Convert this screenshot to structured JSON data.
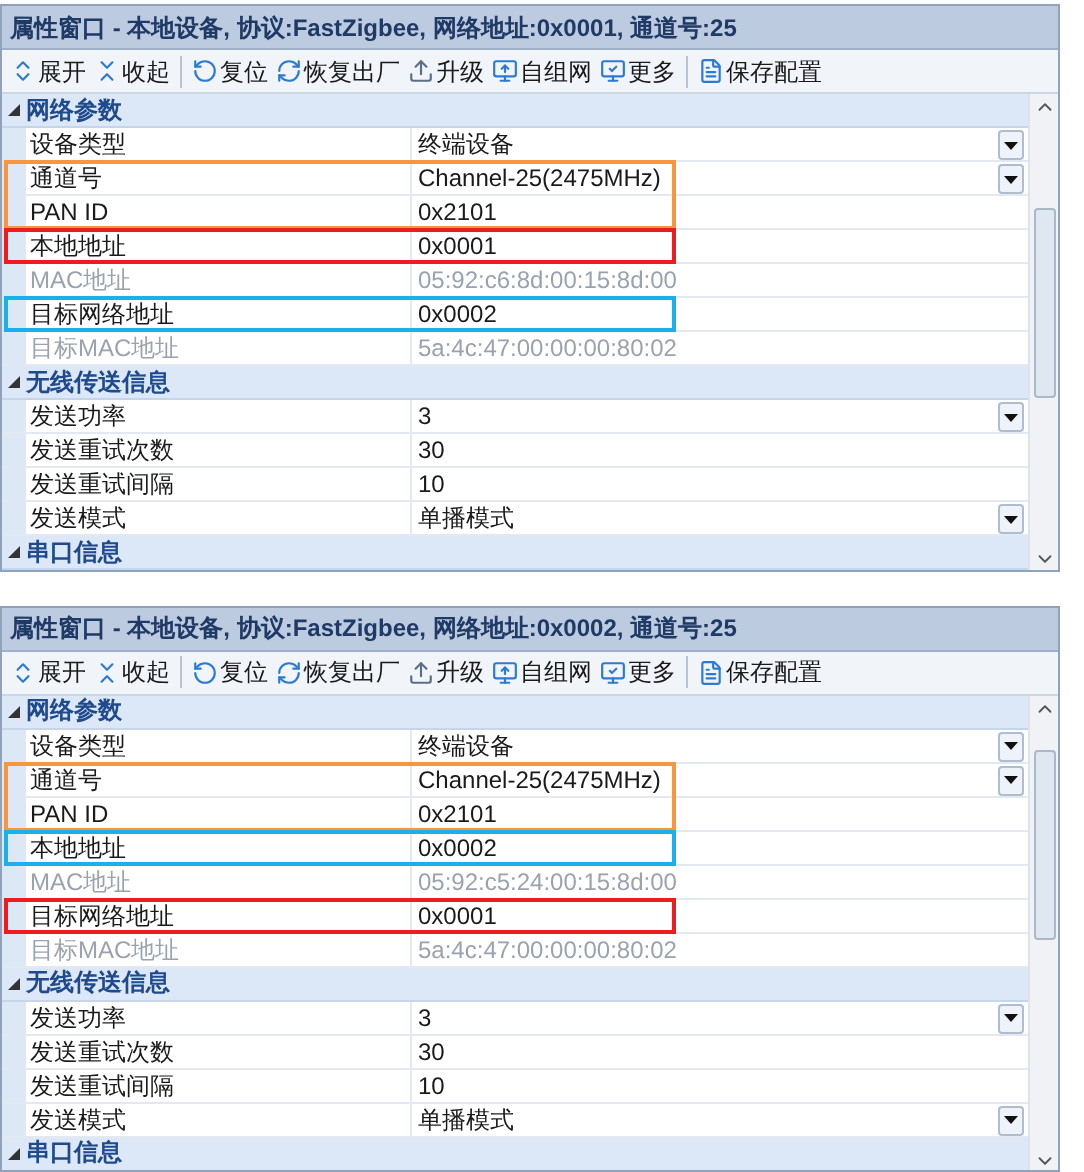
{
  "panels": [
    {
      "title": "属性窗口 - 本地设备, 协议:FastZigbee, 网络地址:0x0001, 通道号:25",
      "toolbar": [
        [
          {
            "label": "展开",
            "kind": "expand"
          },
          {
            "label": "收起",
            "kind": "collapse"
          }
        ],
        [
          {
            "label": "复位",
            "kind": "reset"
          },
          {
            "label": "恢复出厂",
            "kind": "restore"
          },
          {
            "label": "升级",
            "kind": "upgrade"
          },
          {
            "label": "自组网",
            "kind": "network"
          },
          {
            "label": "更多",
            "kind": "more"
          }
        ],
        [
          {
            "label": "保存配置",
            "kind": "save"
          }
        ]
      ],
      "categories": [
        {
          "name": "网络参数",
          "expanded": true,
          "rows": [
            {
              "label": "设备类型",
              "value": "终端设备",
              "kind": "dropdown"
            },
            {
              "label": "通道号",
              "value": "Channel-25(2475MHz)",
              "kind": "dropdown",
              "color": "#f7963c"
            },
            {
              "label": "PAN ID",
              "value": "0x2101",
              "kind": "text",
              "color": "#f7963c"
            },
            {
              "label": "本地地址",
              "value": "0x0001",
              "kind": "text",
              "color": "#ee1c1c"
            },
            {
              "label": "MAC地址",
              "value": "05:92:c6:8d:00:15:8d:00",
              "kind": "readonly"
            },
            {
              "label": "目标网络地址",
              "value": "0x0002",
              "kind": "text",
              "color": "#1ab0ec"
            },
            {
              "label": "目标MAC地址",
              "value": "5a:4c:47:00:00:00:80:02",
              "kind": "readonly"
            }
          ]
        },
        {
          "name": "无线传送信息",
          "expanded": true,
          "rows": [
            {
              "label": "发送功率",
              "value": "3",
              "kind": "dropdown"
            },
            {
              "label": "发送重试次数",
              "value": "30",
              "kind": "text"
            },
            {
              "label": "发送重试间隔",
              "value": "10",
              "kind": "text"
            },
            {
              "label": "发送模式",
              "value": "单播模式",
              "kind": "dropdown"
            }
          ]
        },
        {
          "name": "串口信息",
          "expanded": true
        }
      ]
    },
    {
      "title": "属性窗口 - 本地设备, 协议:FastZigbee, 网络地址:0x0002, 通道号:25",
      "toolbar": [
        [
          {
            "label": "展开",
            "kind": "expand"
          },
          {
            "label": "收起",
            "kind": "collapse"
          }
        ],
        [
          {
            "label": "复位",
            "kind": "reset"
          },
          {
            "label": "恢复出厂",
            "kind": "restore"
          },
          {
            "label": "升级",
            "kind": "upgrade"
          },
          {
            "label": "自组网",
            "kind": "network"
          },
          {
            "label": "更多",
            "kind": "more"
          }
        ],
        [
          {
            "label": "保存配置",
            "kind": "save"
          }
        ]
      ],
      "categories": [
        {
          "name": "网络参数",
          "expanded": true,
          "rows": [
            {
              "label": "设备类型",
              "value": "终端设备",
              "kind": "dropdown"
            },
            {
              "label": "通道号",
              "value": "Channel-25(2475MHz)",
              "kind": "dropdown",
              "color": "#f7963c"
            },
            {
              "label": "PAN ID",
              "value": "0x2101",
              "kind": "text",
              "color": "#f7963c"
            },
            {
              "label": "本地地址",
              "value": "0x0002",
              "kind": "text",
              "color": "#1ab0ec"
            },
            {
              "label": "MAC地址",
              "value": "05:92:c5:24:00:15:8d:00",
              "kind": "readonly"
            },
            {
              "label": "目标网络地址",
              "value": "0x0001",
              "kind": "text",
              "color": "#ee1c1c"
            },
            {
              "label": "目标MAC地址",
              "value": "5a:4c:47:00:00:00:80:02",
              "kind": "readonly"
            }
          ]
        },
        {
          "name": "无线传送信息",
          "expanded": true,
          "rows": [
            {
              "label": "发送功率",
              "value": "3",
              "kind": "dropdown"
            },
            {
              "label": "发送重试次数",
              "value": "30",
              "kind": "text"
            },
            {
              "label": "发送重试间隔",
              "value": "10",
              "kind": "text"
            },
            {
              "label": "发送模式",
              "value": "单播模式",
              "kind": "dropdown"
            }
          ]
        },
        {
          "name": "串口信息",
          "expanded": true
        }
      ]
    }
  ]
}
